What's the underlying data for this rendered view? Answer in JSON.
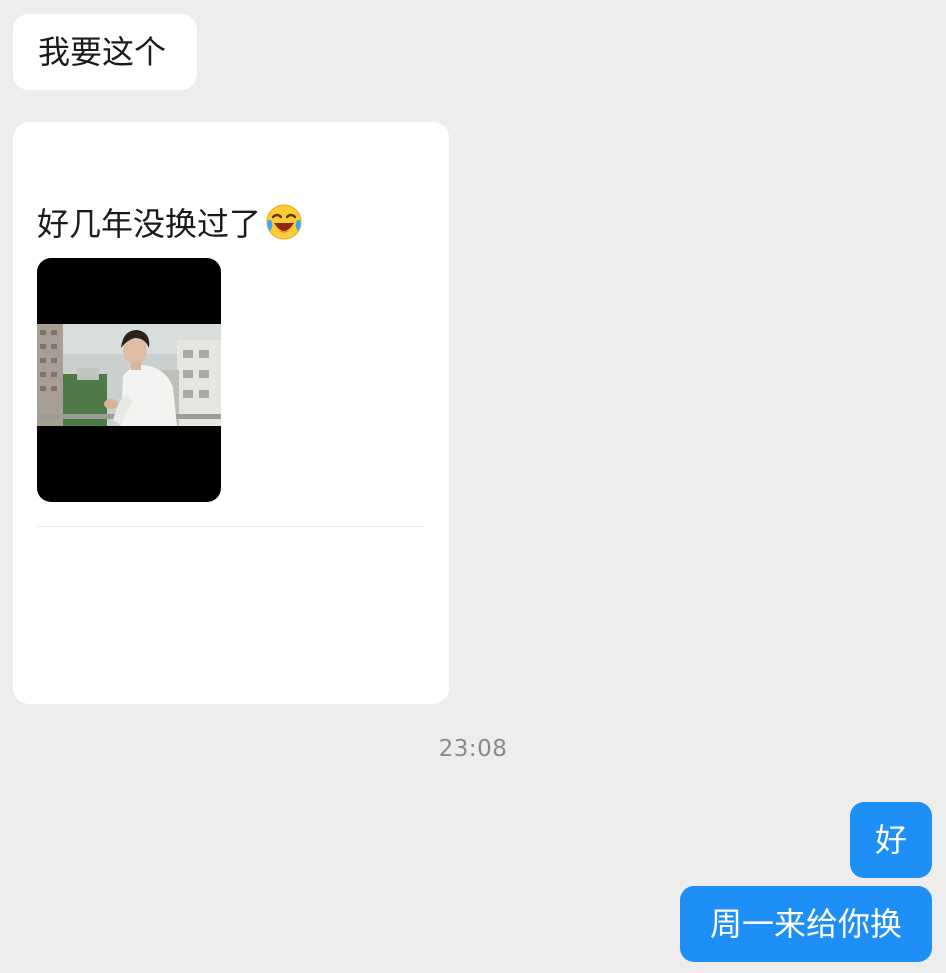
{
  "colors": {
    "background": "#ededed",
    "incoming_bubble": "#ffffff",
    "outgoing_bubble": "#1d8ff7",
    "outgoing_text": "#ffffff",
    "timestamp_text": "#8a8a8a"
  },
  "messages": [
    {
      "direction": "incoming",
      "text": "我要这个"
    },
    {
      "direction": "incoming",
      "type": "card",
      "text": "好几年没换过了",
      "emoji": "crying-laughing-face-icon",
      "has_image": true
    },
    {
      "direction": "outgoing",
      "text": "好"
    },
    {
      "direction": "outgoing",
      "text": "周一来给你换"
    }
  ],
  "timestamp": "23:08"
}
